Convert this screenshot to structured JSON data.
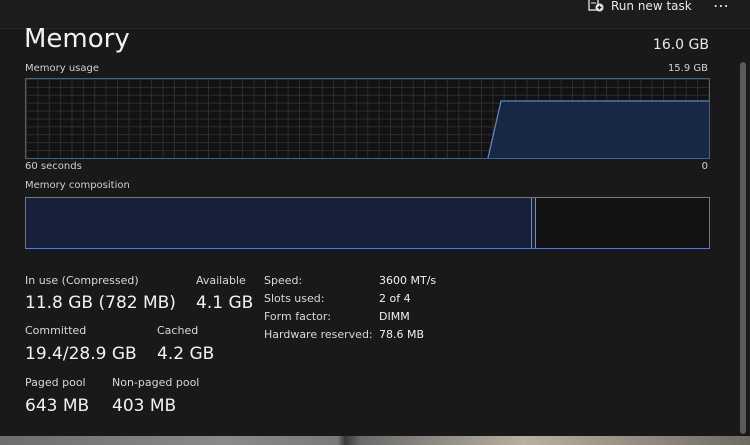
{
  "toolbar": {
    "run_new_task": "Run new task",
    "more": "⋯"
  },
  "header": {
    "title": "Memory",
    "total": "16.0 GB"
  },
  "usage_graph": {
    "label": "Memory usage",
    "max_label": "15.9 GB",
    "time_left": "60 seconds",
    "time_right": "0",
    "line_color": "#5a85c8",
    "fill_color": "#172845"
  },
  "composition": {
    "label": "Memory composition",
    "in_use_fraction": 0.74,
    "modified_fraction": 0.004
  },
  "stats": {
    "in_use_label": "In use (Compressed)",
    "in_use_value": "11.8 GB (782 MB)",
    "available_label": "Available",
    "available_value": "4.1 GB",
    "committed_label": "Committed",
    "committed_value": "19.4/28.9 GB",
    "cached_label": "Cached",
    "cached_value": "4.2 GB",
    "paged_label": "Paged pool",
    "paged_value": "643 MB",
    "nonpaged_label": "Non-paged pool",
    "nonpaged_value": "403 MB"
  },
  "specs": {
    "speed_label": "Speed:",
    "speed_value": "3600 MT/s",
    "slots_label": "Slots used:",
    "slots_value": "2 of 4",
    "form_label": "Form factor:",
    "form_value": "DIMM",
    "reserved_label": "Hardware reserved:",
    "reserved_value": "78.6 MB"
  }
}
